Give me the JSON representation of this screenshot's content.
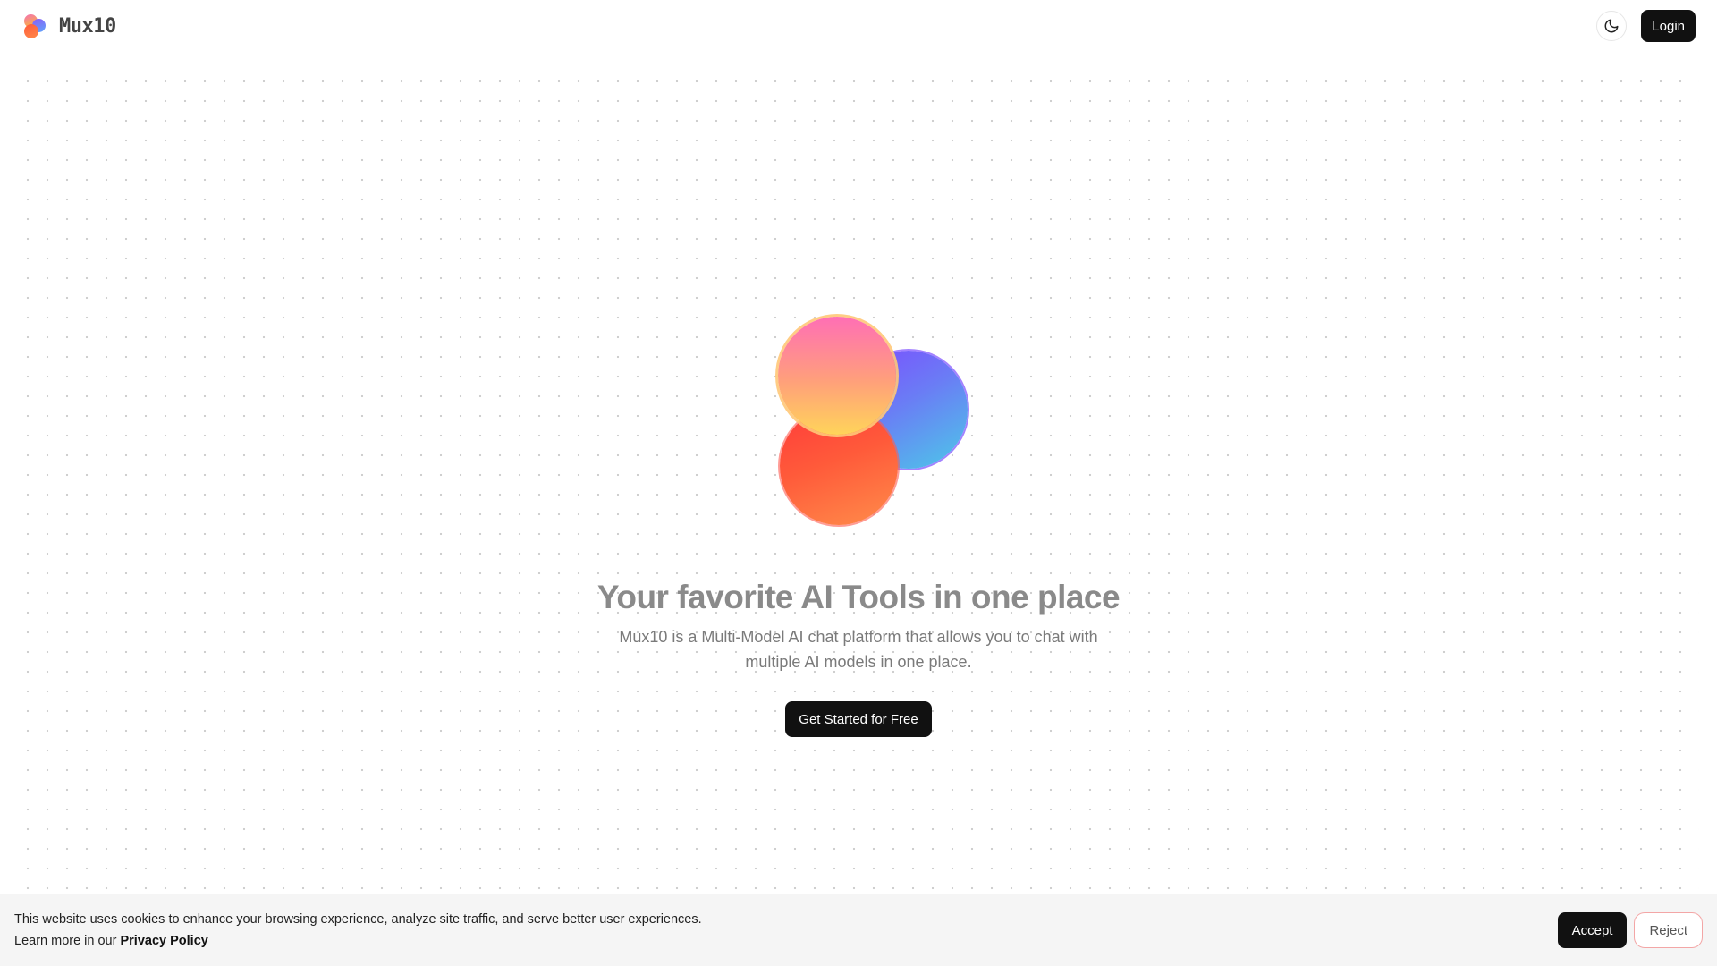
{
  "header": {
    "brand_name": "Mux10",
    "theme_toggle_icon": "moon-icon",
    "login_label": "Login"
  },
  "hero": {
    "title": "Your favorite AI Tools in one place",
    "subtitle": "Mux10 is a Multi-Model AI chat platform that allows you to chat with multiple AI models in one place.",
    "cta_label": "Get Started for Free"
  },
  "cookie_banner": {
    "message": "This website uses cookies to enhance your browsing experience, analyze site traffic, and serve better user experiences.",
    "learn_more_prefix": "Learn more in our",
    "privacy_link": "Privacy Policy",
    "accept_label": "Accept",
    "reject_label": "Reject"
  },
  "colors": {
    "primary_button": "#111111",
    "orb_blue": "#7c4dff",
    "orb_red": "#ff5a3a",
    "orb_pink": "#ff6fb5",
    "reject_border": "#f3a6a6"
  }
}
